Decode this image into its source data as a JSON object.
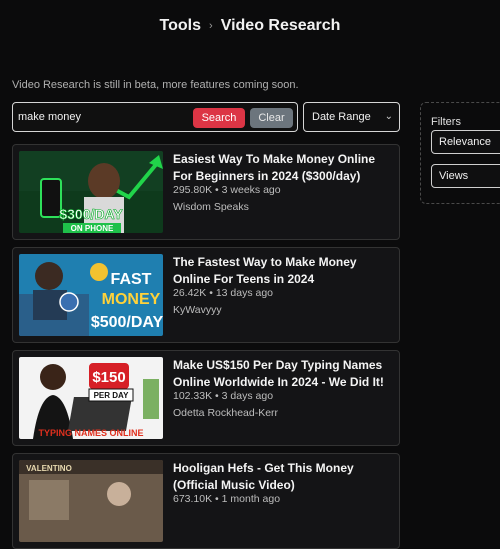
{
  "header": {
    "tools_label": "Tools",
    "separator": "›",
    "page_label": "Video Research"
  },
  "beta_notice": "Video Research is still in beta, more features coming soon.",
  "search": {
    "value": "make money",
    "placeholder": "",
    "search_label": "Search",
    "clear_label": "Clear"
  },
  "date_range": {
    "label": "Date Range"
  },
  "filters": {
    "label": "Filters",
    "sort_value": "Relevance",
    "metric_value": "Views"
  },
  "videos": [
    {
      "title": "Easiest Way To Make Money Online For Beginners in 2024 ($300/day)",
      "views": "295.80K",
      "age": "3 weeks ago",
      "channel": "Wisdom Speaks",
      "thumb_text": [
        "$300/DAY",
        "ON PHONE"
      ]
    },
    {
      "title": "The Fastest Way to Make Money Online For Teens in 2024",
      "views": "26.42K",
      "age": "13 days ago",
      "channel": "KyWavyyy",
      "thumb_text": [
        "FAST",
        "MONEY",
        "$500/DAY"
      ]
    },
    {
      "title": "Make US$150 Per Day Typing Names Online Worldwide In 2024 - We Did It!",
      "views": "102.33K",
      "age": "3 days ago",
      "channel": "Odetta Rockhead-Kerr",
      "thumb_text": [
        "$150",
        "PER DAY",
        "TYPING NAMES ONLINE"
      ]
    },
    {
      "title": "Hooligan Hefs - Get This Money (Official Music Video)",
      "views": "673.10K",
      "age": "1 month ago",
      "channel": "",
      "thumb_text": [
        "VALENTINO"
      ]
    }
  ],
  "meta_separator": "•",
  "colors": {
    "search_button": "#dc3545",
    "clear_button": "#6c757d",
    "background": "#0b0b0c"
  }
}
